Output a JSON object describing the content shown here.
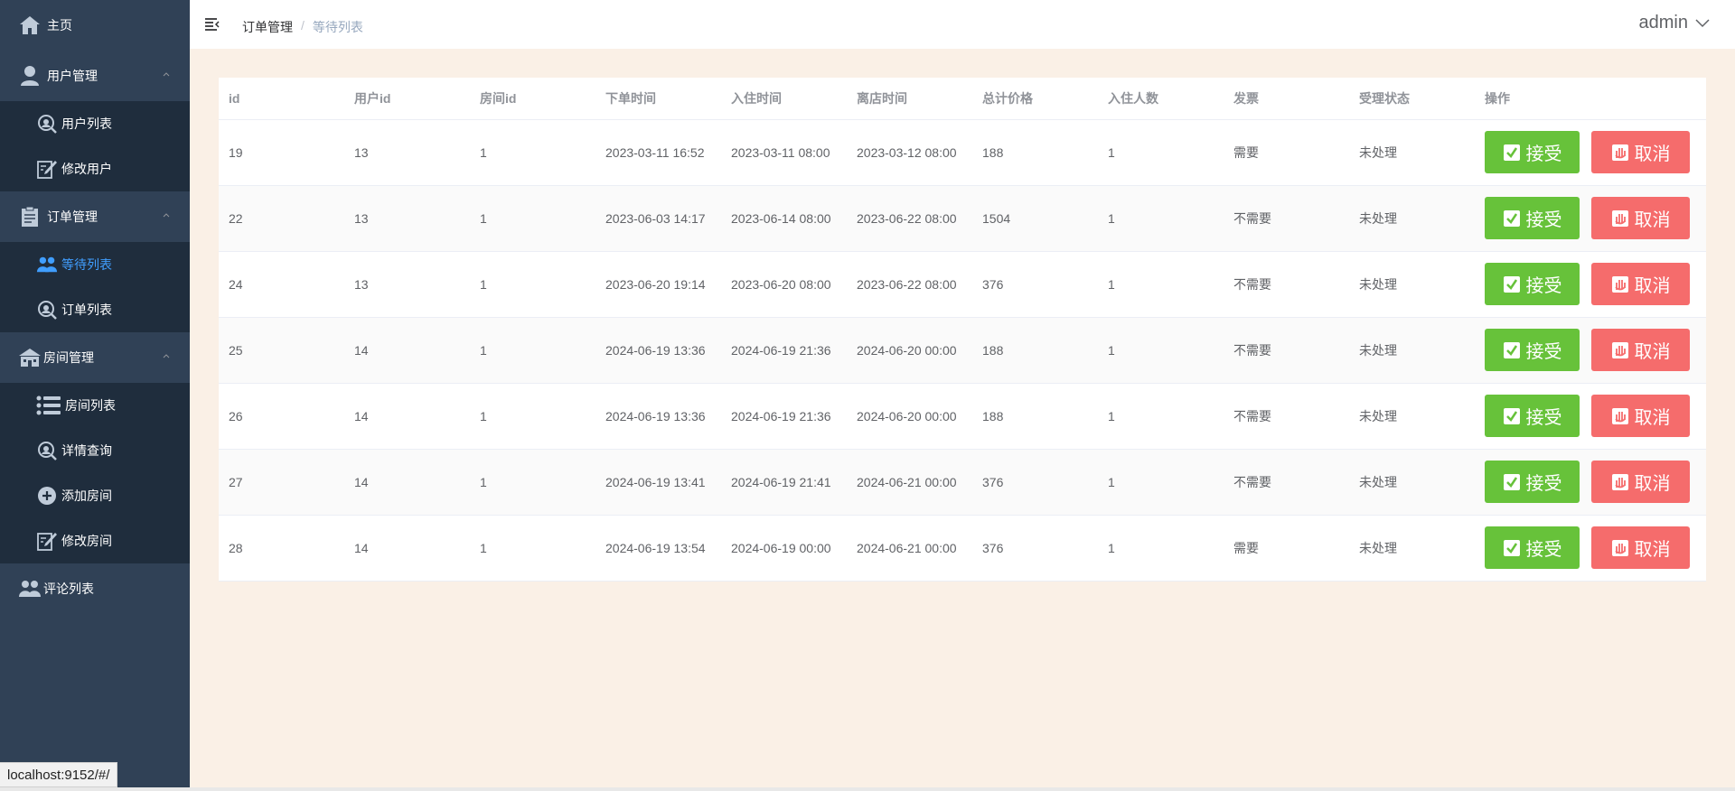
{
  "sidebar": {
    "home": "主页",
    "user_mgmt": "用户管理",
    "user_list": "用户列表",
    "edit_user": "修改用户",
    "order_mgmt": "订单管理",
    "waiting_list": "等待列表",
    "order_list": "订单列表",
    "room_mgmt": "房间管理",
    "room_list": "房间列表",
    "detail_query": "详情查询",
    "add_room": "添加房间",
    "edit_room": "修改房间",
    "comment_list": "评论列表"
  },
  "header": {
    "breadcrumb_parent": "订单管理",
    "breadcrumb_separator": "/",
    "breadcrumb_current": "等待列表",
    "user": "admin"
  },
  "table": {
    "columns": [
      "id",
      "用户id",
      "房间id",
      "下单时间",
      "入住时间",
      "离店时间",
      "总计价格",
      "入住人数",
      "发票",
      "受理状态",
      "操作"
    ],
    "rows": [
      [
        "19",
        "13",
        "1",
        "2023-03-11 16:52",
        "2023-03-11 08:00",
        "2023-03-12 08:00",
        "188",
        "1",
        "需要",
        "未处理"
      ],
      [
        "22",
        "13",
        "1",
        "2023-06-03 14:17",
        "2023-06-14 08:00",
        "2023-06-22 08:00",
        "1504",
        "1",
        "不需要",
        "未处理"
      ],
      [
        "24",
        "13",
        "1",
        "2023-06-20 19:14",
        "2023-06-20 08:00",
        "2023-06-22 08:00",
        "376",
        "1",
        "不需要",
        "未处理"
      ],
      [
        "25",
        "14",
        "1",
        "2024-06-19 13:36",
        "2024-06-19 21:36",
        "2024-06-20 00:00",
        "188",
        "1",
        "不需要",
        "未处理"
      ],
      [
        "26",
        "14",
        "1",
        "2024-06-19 13:36",
        "2024-06-19 21:36",
        "2024-06-20 00:00",
        "188",
        "1",
        "不需要",
        "未处理"
      ],
      [
        "27",
        "14",
        "1",
        "2024-06-19 13:41",
        "2024-06-19 21:41",
        "2024-06-21 00:00",
        "376",
        "1",
        "不需要",
        "未处理"
      ],
      [
        "28",
        "14",
        "1",
        "2024-06-19 13:54",
        "2024-06-19 00:00",
        "2024-06-21 00:00",
        "376",
        "1",
        "需要",
        "未处理"
      ]
    ],
    "accept_label": "接受",
    "cancel_label": "取消"
  },
  "statusbar": "localhost:9152/#/",
  "colors": {
    "sidebar_bg": "#304156",
    "submenu_bg": "#1f2d3d",
    "active": "#409eff",
    "main_bg": "#faf0e6",
    "accept": "#67c23a",
    "cancel": "#f56c6c"
  }
}
